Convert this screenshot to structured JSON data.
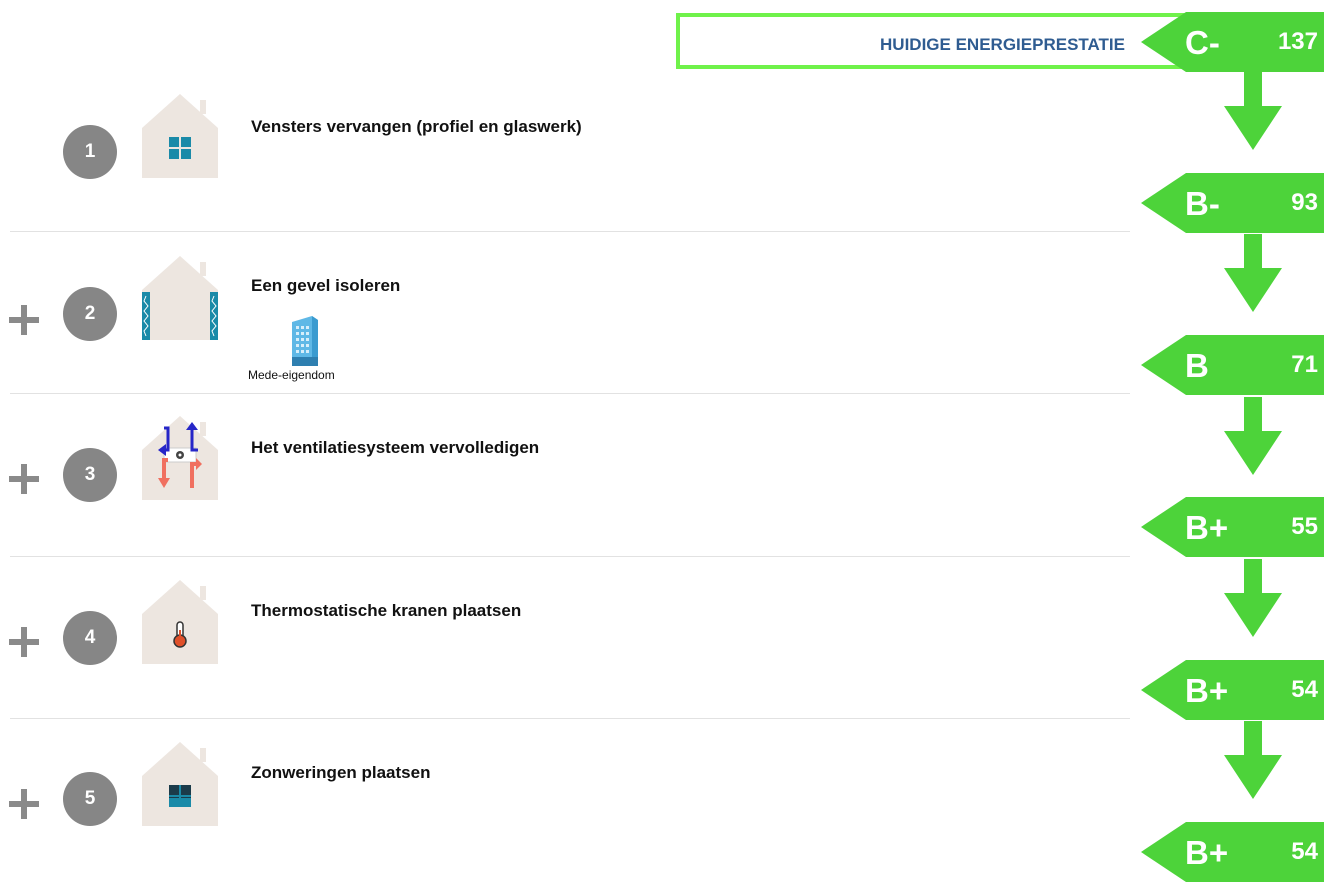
{
  "current": {
    "label": "HUIDIGE ENERGIEPRESTATIE",
    "letter": "C-",
    "value": "137"
  },
  "colors": {
    "arrow_green": "#4dd33a",
    "box_border": "#6ff24a",
    "header_text": "#2f5c91",
    "circle_gray": "#868686"
  },
  "steps": [
    {
      "number": "1",
      "title": "Vensters vervangen (profiel en glaswerk)",
      "icon": "window-house-icon",
      "show_plus": false,
      "result_letter": "B-",
      "result_value": "93"
    },
    {
      "number": "2",
      "title": "Een gevel isoleren",
      "icon": "insulated-wall-house-icon",
      "show_plus": true,
      "result_letter": "B",
      "result_value": "71",
      "co_ownership": {
        "icon": "apartment-building-icon",
        "label": "Mede-eigendom"
      }
    },
    {
      "number": "3",
      "title": "Het ventilatiesysteem vervolledigen",
      "icon": "ventilation-house-icon",
      "show_plus": true,
      "result_letter": "B+",
      "result_value": "55"
    },
    {
      "number": "4",
      "title": "Thermostatische kranen plaatsen",
      "icon": "thermometer-house-icon",
      "show_plus": true,
      "result_letter": "B+",
      "result_value": "54"
    },
    {
      "number": "5",
      "title": "Zonweringen plaatsen",
      "icon": "shaded-window-house-icon",
      "show_plus": true,
      "result_letter": "B+",
      "result_value": "54"
    }
  ]
}
